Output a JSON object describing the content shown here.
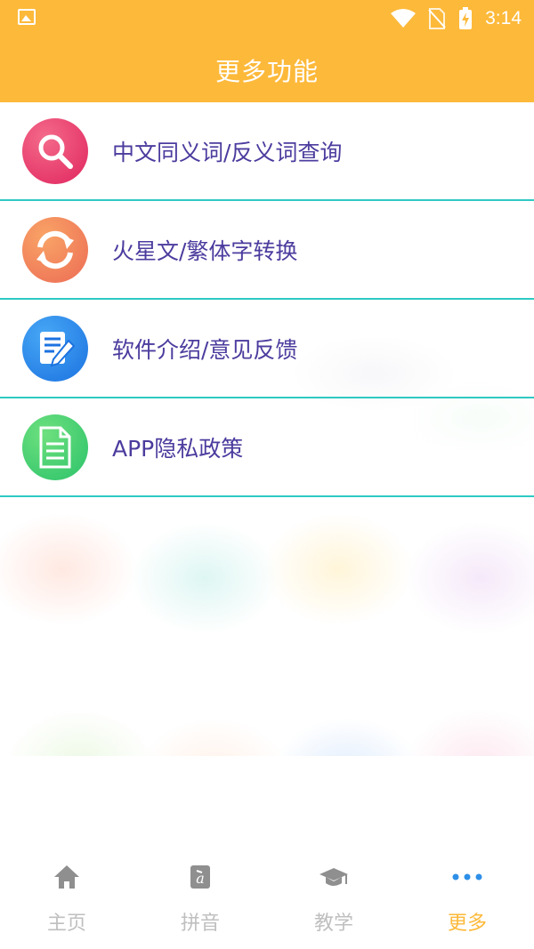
{
  "status_bar": {
    "time": "3:14"
  },
  "header": {
    "title": "更多功能"
  },
  "menu": {
    "items": [
      {
        "label": "中文同义词/反义词查询",
        "icon": "search-icon"
      },
      {
        "label": "火星文/繁体字转换",
        "icon": "convert-icon"
      },
      {
        "label": "软件介绍/意见反馈",
        "icon": "edit-icon"
      },
      {
        "label": "APP隐私政策",
        "icon": "document-icon"
      }
    ]
  },
  "bottom_nav": {
    "items": [
      {
        "label": "主页",
        "icon": "home-icon"
      },
      {
        "label": "拼音",
        "icon": "pinyin-icon"
      },
      {
        "label": "教学",
        "icon": "graduation-cap-icon"
      },
      {
        "label": "更多",
        "icon": "more-dots-icon",
        "active": true
      }
    ]
  },
  "colors": {
    "header": "#FDB93A",
    "divider": "#2EC9C3",
    "menu_text": "#4B3C9E",
    "nav_inactive": "#BFBFBF",
    "nav_active": "#FDB93A"
  }
}
